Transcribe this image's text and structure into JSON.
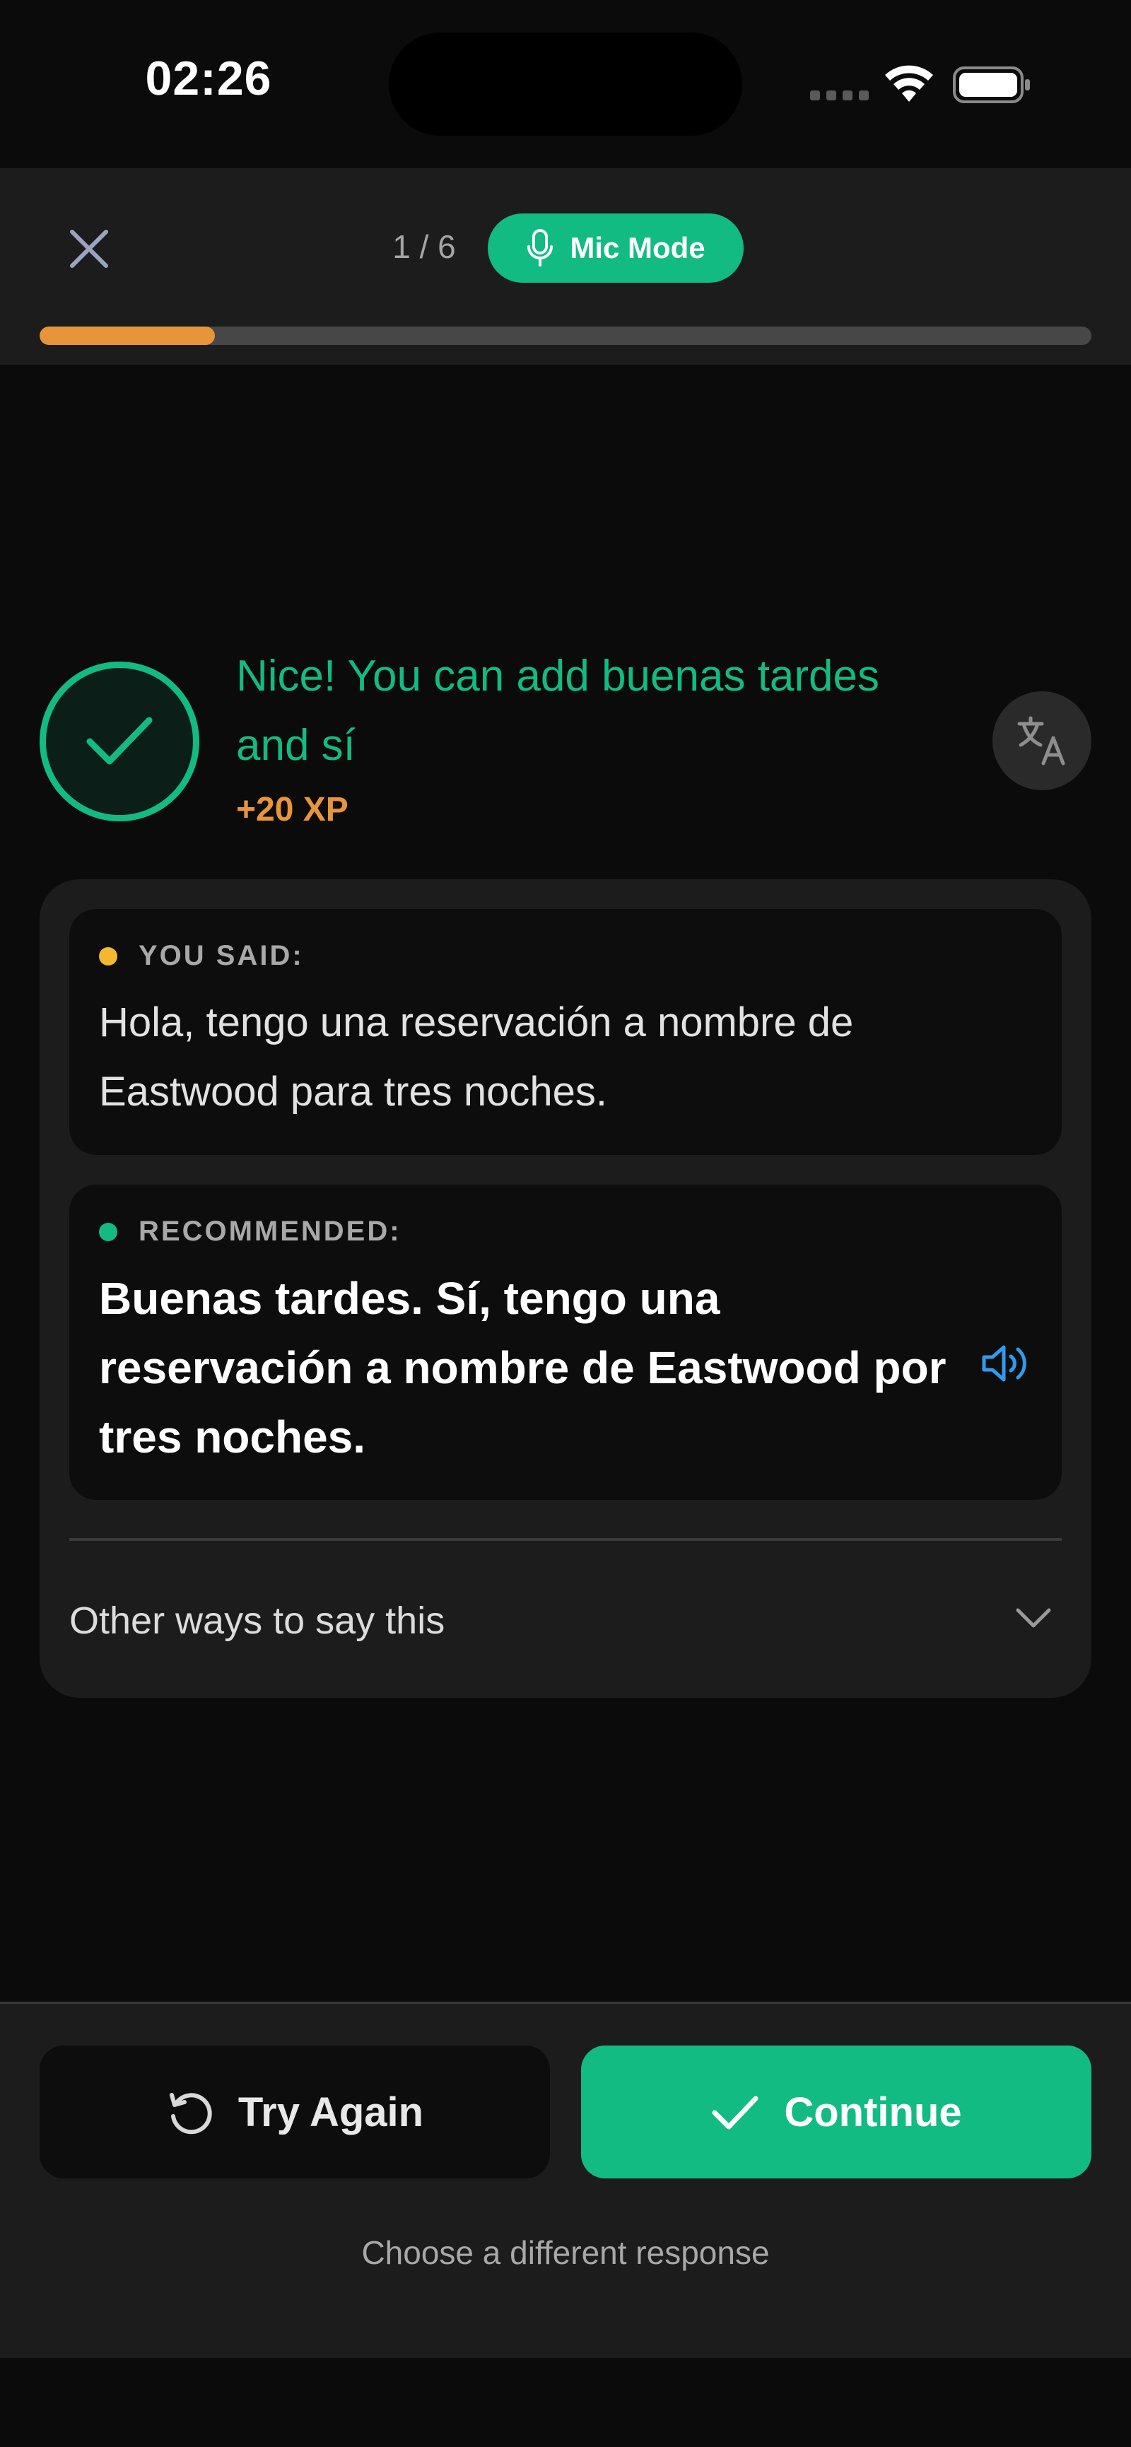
{
  "status_bar": {
    "time": "02:26"
  },
  "header": {
    "progress_text": "1 / 6",
    "progress_fraction": 0.167,
    "mic_mode_label": "Mic Mode"
  },
  "feedback": {
    "title": "Nice! You can add buenas tardes and sí",
    "xp": "+20 XP"
  },
  "you_said": {
    "label": "YOU SAID:",
    "text": "Hola, tengo una reservación a nombre de Eastwood para tres noches."
  },
  "recommended": {
    "label": "RECOMMENDED:",
    "text": "Buenas tardes. Sí, tengo una reservación a nombre de Eastwood por tres noches."
  },
  "other_ways": {
    "label": "Other ways to say this"
  },
  "actions": {
    "try_again": "Try Again",
    "continue": "Continue",
    "different_response": "Choose a different response"
  },
  "colors": {
    "accent_green": "#12bb82",
    "accent_orange": "#e8953a",
    "you_said_dot": "#f2b82e",
    "speaker_blue": "#2f9bf0"
  },
  "icons": {
    "close": "close-icon",
    "mic": "microphone-icon",
    "check": "checkmark-icon",
    "translate": "translate-icon",
    "speaker": "speaker-icon",
    "chevron": "chevron-down-icon",
    "retry": "retry-icon"
  }
}
